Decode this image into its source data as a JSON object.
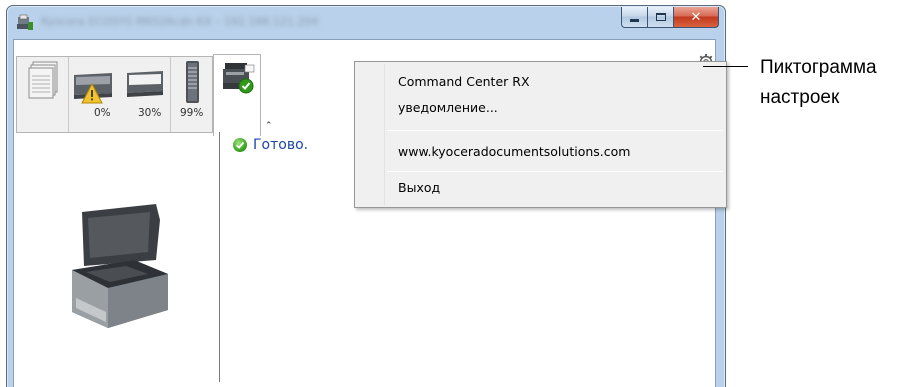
{
  "window": {
    "title": "Kyocera ECOSYS M6526cdn KX – 192.168.121.204",
    "close_glyph": "✕"
  },
  "tabs": {
    "status_percentages": [
      "0%",
      "30%",
      "99%"
    ],
    "collapse_glyph": "⌃"
  },
  "status": {
    "text": "Готово."
  },
  "context_menu": {
    "items": [
      {
        "label": "Command Center RX"
      },
      {
        "label": "уведомление..."
      },
      {
        "label": "www.kyoceradocumentsolutions.com"
      },
      {
        "label": "Выход"
      }
    ]
  },
  "callout": {
    "line1": "Пиктограмма",
    "line2": "настроек"
  },
  "colors": {
    "status_text": "#1c46a8",
    "frame": "#b9d1ea",
    "close_button": "#c2391d",
    "ok_green": "#2f9a1a"
  }
}
